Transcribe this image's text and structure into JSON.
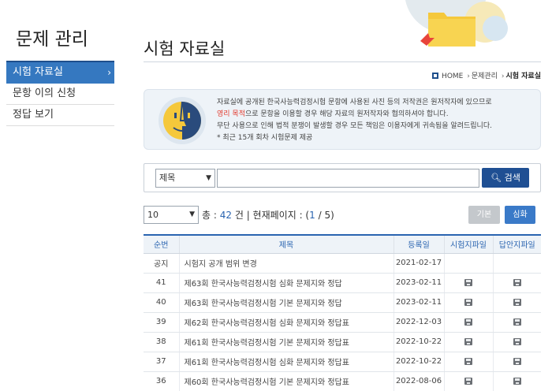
{
  "sidebar": {
    "title": "문제 관리",
    "items": [
      {
        "label": "시험 자료실",
        "active": true
      },
      {
        "label": "문항 이의 신청",
        "active": false
      },
      {
        "label": "정답 보기",
        "active": false
      }
    ]
  },
  "page": {
    "title": "시험 자료실"
  },
  "breadcrumb": {
    "home": "HOME",
    "level1": "문제관리",
    "current": "시험 자료실"
  },
  "notice": {
    "line1": "자료실에 공개된 한국사능력검정시험 문항에 사용된 사진 등의 저작권은 원저작자에 있으므로",
    "line2_red": "영리 목적",
    "line2_rest": "으로 문항을 이용할 경우 해당 자료의 원저작자와 협의하셔야 합니다.",
    "line3": "무단 사용으로 인해 법적 분쟁이 발생할 경우 모든 책임은 이용자에게 귀속됨을 알려드립니다.",
    "line4": "* 최근 15개 회차 시험문제 제공"
  },
  "search": {
    "field": "제목",
    "query": "",
    "button": "검색"
  },
  "listing": {
    "page_size": "10",
    "total_label": "총 :",
    "total": "42",
    "total_unit": "건 | 현재페이지 : (",
    "current_page": "1",
    "page_sep": " / 5)",
    "btn_basic": "기본",
    "btn_advanced": "심화"
  },
  "table": {
    "headers": [
      "순번",
      "제목",
      "등록일",
      "시험지파일",
      "답안지파일"
    ],
    "rows": [
      {
        "no": "공지",
        "title": "시험지 공개 범위 변경",
        "date": "2021-02-17",
        "exam_file": false,
        "answer_file": false
      },
      {
        "no": "41",
        "title": "제63회 한국사능력검정시험 심화 문제지와 정답",
        "date": "2023-02-11",
        "exam_file": true,
        "answer_file": true
      },
      {
        "no": "40",
        "title": "제63회 한국사능력검정시험 기본 문제지와 정답",
        "date": "2023-02-11",
        "exam_file": true,
        "answer_file": true
      },
      {
        "no": "39",
        "title": "제62회 한국사능력검정시험 심화 문제지와 정답표",
        "date": "2022-12-03",
        "exam_file": true,
        "answer_file": true
      },
      {
        "no": "38",
        "title": "제61회 한국사능력검정시험 기본 문제지와 정답표",
        "date": "2022-10-22",
        "exam_file": true,
        "answer_file": true
      },
      {
        "no": "37",
        "title": "제61회 한국사능력검정시험 심화 문제지와 정답표",
        "date": "2022-10-22",
        "exam_file": true,
        "answer_file": true
      },
      {
        "no": "36",
        "title": "제60회 한국사능력검정시험 기본 문제지와 정답표",
        "date": "2022-08-06",
        "exam_file": true,
        "answer_file": true
      }
    ]
  }
}
